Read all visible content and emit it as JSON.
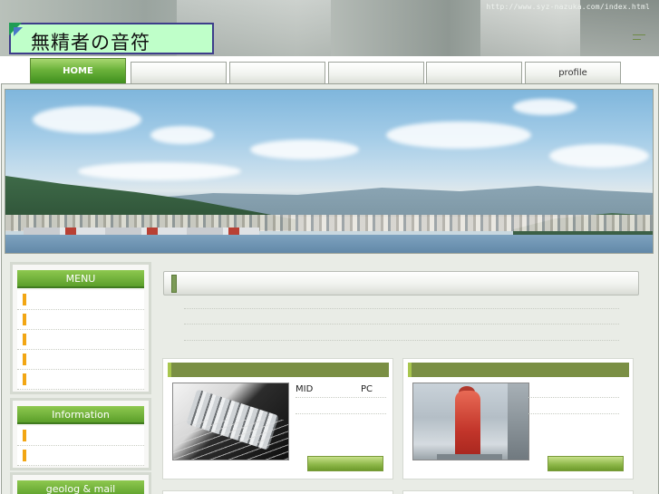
{
  "header": {
    "url_text": "http://www.syz-nazuka.com/index.html",
    "logo_text": "無精者の音符"
  },
  "nav": {
    "tabs": [
      {
        "label": "HOME",
        "active": true
      },
      {
        "label": ""
      },
      {
        "label": ""
      },
      {
        "label": ""
      },
      {
        "label": ""
      },
      {
        "label": "profile"
      }
    ]
  },
  "sidebar": {
    "menu_title": "MENU",
    "information_title": "Information",
    "geolog_title": "geolog & mail"
  },
  "cards": [
    {
      "text_left": "MID",
      "text_right": "PC",
      "thumbnail": "guitar-bridge-photo"
    },
    {
      "text_left": "",
      "text_right": "",
      "thumbnail": "red-figure-photo"
    }
  ],
  "colors": {
    "accent_green": "#5b9f2a",
    "card_strip": "#7a8f44",
    "bullet_orange": "#f2a614",
    "logo_bg": "#bfffc9"
  }
}
